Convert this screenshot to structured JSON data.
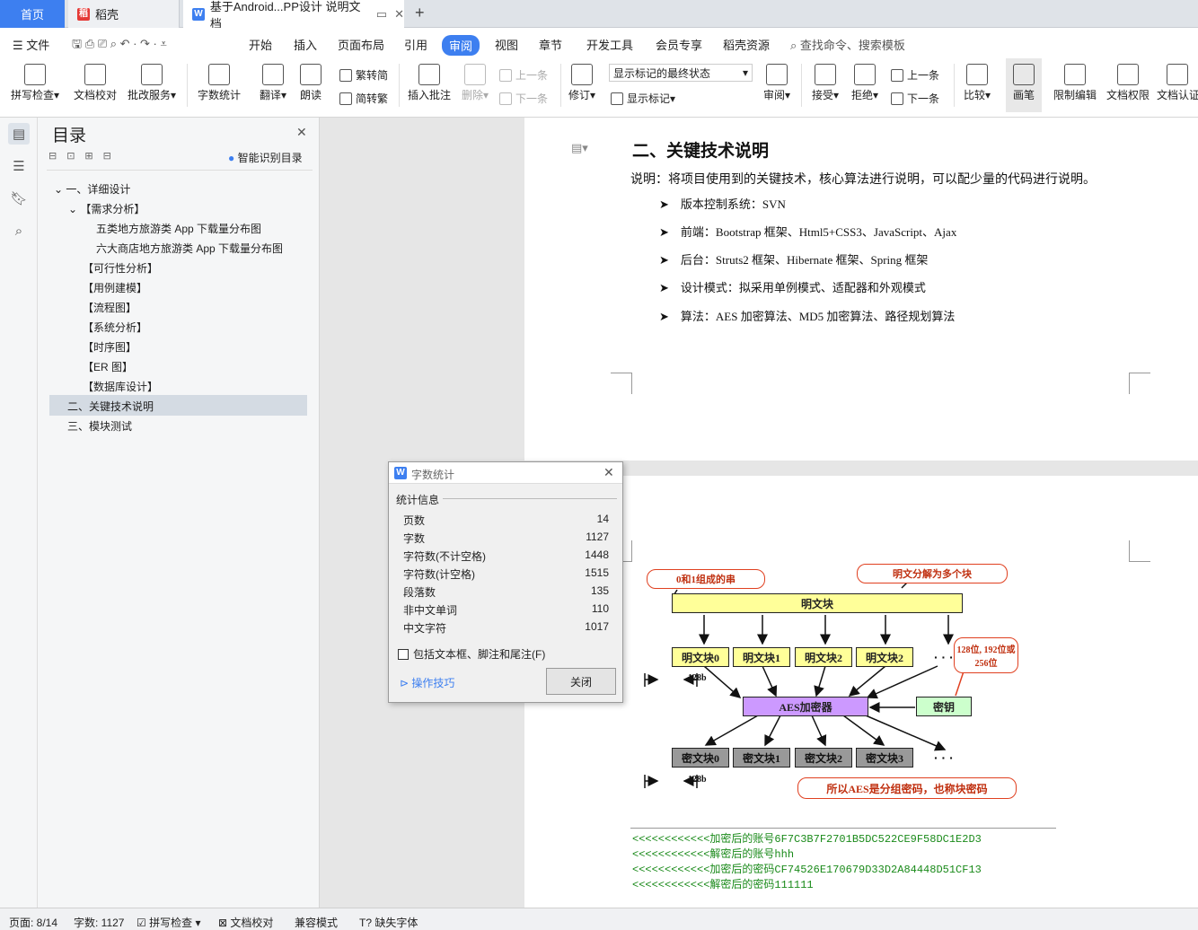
{
  "tabs": {
    "home": "首页",
    "daoke": "稻壳",
    "doc": "基于Android...PP设计 说明文档"
  },
  "menu": {
    "file": "文件",
    "items": [
      "开始",
      "插入",
      "页面布局",
      "引用",
      "审阅",
      "视图",
      "章节",
      "开发工具",
      "会员专享",
      "稻壳资源"
    ],
    "search": "查找命令、搜索模板"
  },
  "ribbon": {
    "spell": "拼写检查",
    "proof": "文档校对",
    "correct": "批改服务",
    "wordcount": "字数统计",
    "translate": "翻译",
    "read": "朗读",
    "trad2simp": "繁转简",
    "simp2trad": "简转繁",
    "add_comment": "插入批注",
    "delete": "删除",
    "prev": "上一条",
    "next": "下一条",
    "revise": "修订",
    "markup_state": "显示标记的最终状态",
    "show_markup": "显示标记",
    "review": "审阅",
    "accept": "接受",
    "reject": "拒绝",
    "prev2": "上一条",
    "next2": "下一条",
    "compare": "比较",
    "pen": "画笔",
    "restrict": "限制编辑",
    "perm": "文档权限",
    "cert": "文档认证"
  },
  "toc": {
    "title": "目录",
    "smart": "智能识别目录",
    "items": [
      "一、详细设计",
      "【需求分析】",
      "五类地方旅游类 App 下载量分布图",
      "六大商店地方旅游类 App 下载量分布图",
      "【可行性分析】",
      "【用例建模】",
      "【流程图】",
      "【系统分析】",
      "【时序图】",
      "【ER 图】",
      "【数据库设计】",
      "二、关键技术说明",
      "三、模块测试"
    ]
  },
  "doc": {
    "heading": "二、关键技术说明",
    "intro": "说明：将项目使用到的关键技术，核心算法进行说明，可以配少量的代码进行说明。",
    "bullets": [
      "版本控制系统：SVN",
      "前端：Bootstrap 框架、Html5+CSS3、JavaScript、Ajax",
      "后台：Struts2 框架、Hibernate 框架、Spring 框架",
      "设计模式：拟采用单例模式、适配器和外观模式",
      "算法：AES 加密算法、MD5 加密算法、路径规划算法"
    ],
    "code": [
      "<<<<<<<<<<<<加密后的账号6F7C3B7F2701B5DC522CE9F58DC1E2D3",
      "<<<<<<<<<<<<解密后的账号hhh",
      "<<<<<<<<<<<<加密后的密码CF74526E170679D33D2A84448D51CF13",
      "<<<<<<<<<<<<解密后的密码111111"
    ]
  },
  "diagram": {
    "callout1": "0和1组成的串",
    "callout2": "明文分解为多个块",
    "plain": "明文块",
    "pblocks": [
      "明文块0",
      "明文块1",
      "明文块2",
      "明文块2"
    ],
    "dots": "· · ·",
    "bits": "128b",
    "callout3": "128位, 192位或256位",
    "aes": "AES加密器",
    "key": "密钥",
    "cblocks": [
      "密文块0",
      "密文块1",
      "密文块2",
      "密文块3"
    ],
    "callout4": "所以AES是分组密码，也称块密码"
  },
  "dialog": {
    "title": "字数统计",
    "section": "统计信息",
    "rows": [
      [
        "页数",
        "14"
      ],
      [
        "字数",
        "1127"
      ],
      [
        "字符数(不计空格)",
        "1448"
      ],
      [
        "字符数(计空格)",
        "1515"
      ],
      [
        "段落数",
        "135"
      ],
      [
        "非中文单词",
        "110"
      ],
      [
        "中文字符",
        "1017"
      ]
    ],
    "checkbox": "包括文本框、脚注和尾注(F)",
    "tips": "操作技巧",
    "close": "关闭"
  },
  "status": {
    "page": "页面: 8/14",
    "words": "字数: 1127",
    "spell": "拼写检查",
    "proof": "文档校对",
    "compat": "兼容模式",
    "font": "缺失字体"
  }
}
